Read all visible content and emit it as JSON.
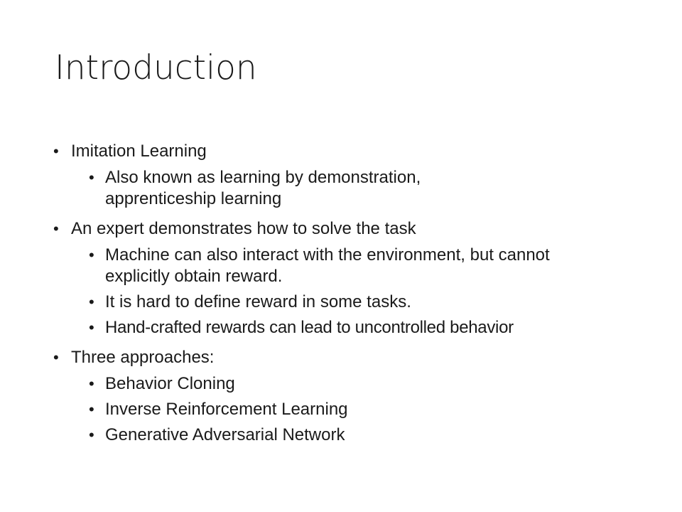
{
  "slide": {
    "title": "Introduction",
    "bullet_glyph": "•",
    "items": [
      {
        "text": "Imitation Learning",
        "subitems": [
          "Also known as learning by demonstration, apprenticeship learning"
        ]
      },
      {
        "text": "An expert demonstrates how to solve the task",
        "subitems": [
          "Machine can also interact with the environment, but cannot explicitly obtain reward.",
          "It is hard to define reward in some tasks.",
          "Hand-crafted rewards can lead to uncontrolled behavior"
        ]
      },
      {
        "text": "Three approaches:",
        "subitems": [
          "Behavior Cloning",
          "Inverse Reinforcement Learning",
          "Generative Adversarial Network"
        ]
      }
    ]
  }
}
